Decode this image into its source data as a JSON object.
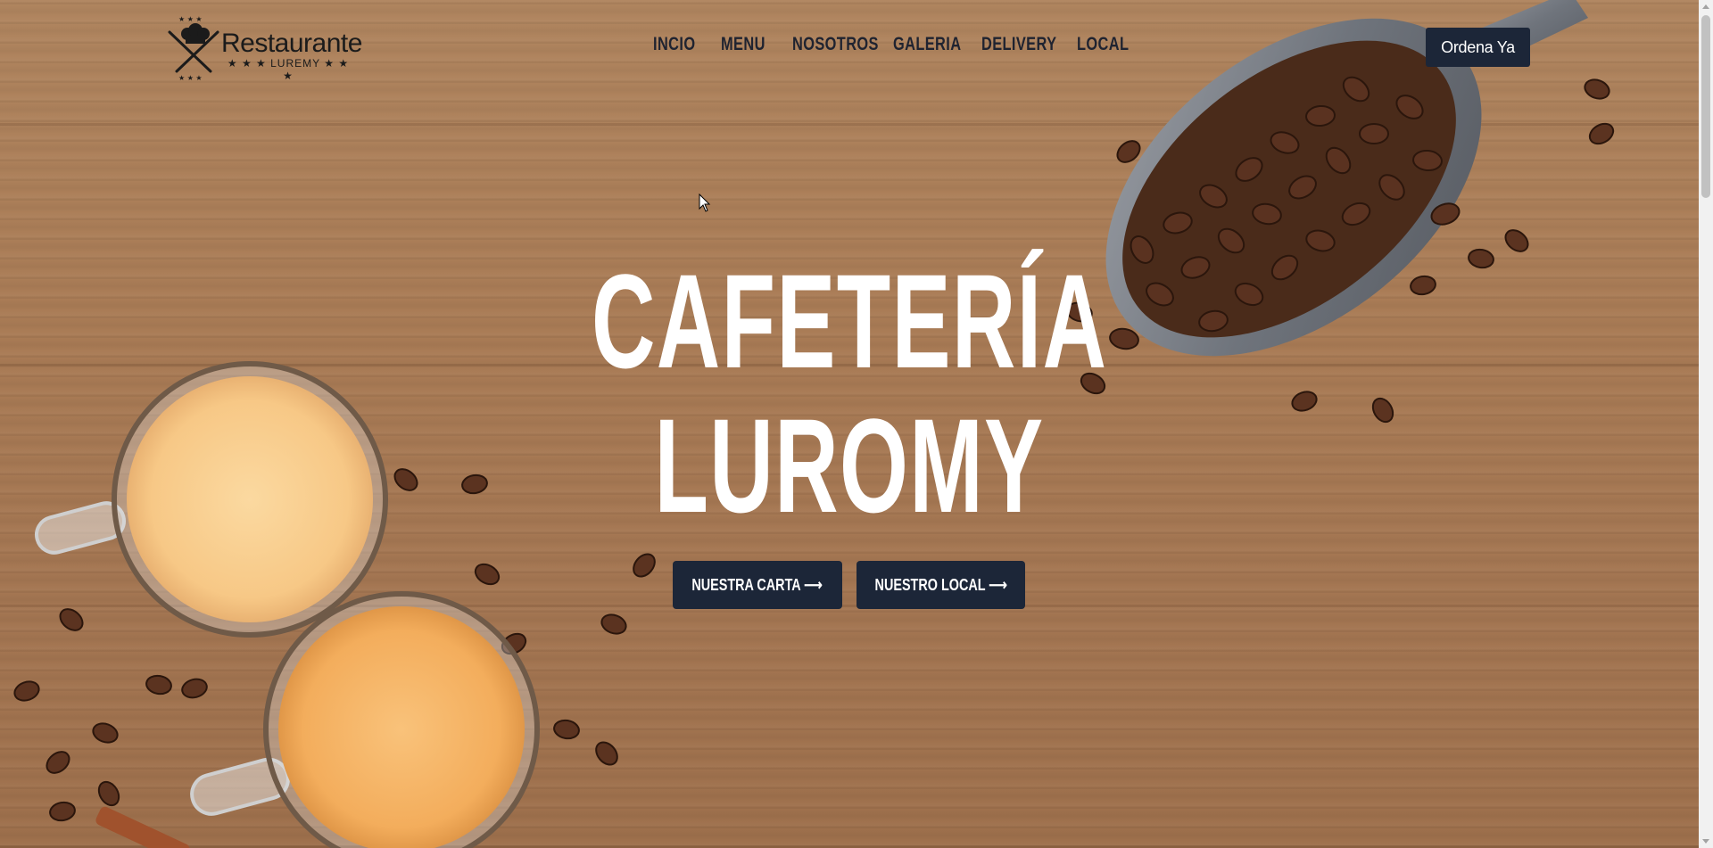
{
  "brand": {
    "logo_title": "Restaurante",
    "logo_subtitle": "★ ★ ★ LUREMY ★ ★ ★"
  },
  "nav": {
    "items": [
      {
        "label": "INCIO"
      },
      {
        "label": "MENU"
      },
      {
        "label": "NOSOTROS"
      },
      {
        "label": "GALERIA"
      },
      {
        "label": "DELIVERY"
      },
      {
        "label": "LOCAL"
      }
    ],
    "order_button": "Ordena Ya"
  },
  "hero": {
    "title_line1": "CAFETERÍA",
    "title_line2": "LUROMY",
    "buttons": [
      {
        "label": "NUESTRA CARTA ⟶"
      },
      {
        "label": "NUESTRO LOCAL ⟶"
      }
    ]
  },
  "colors": {
    "primary_dark": "#1c2638",
    "wood": "#a87a55",
    "hero_text": "#ffffff"
  },
  "icons": [
    "chef-hat-icon",
    "crossed-utensils-icon",
    "arrow-right-icon",
    "mouse-cursor-icon"
  ]
}
